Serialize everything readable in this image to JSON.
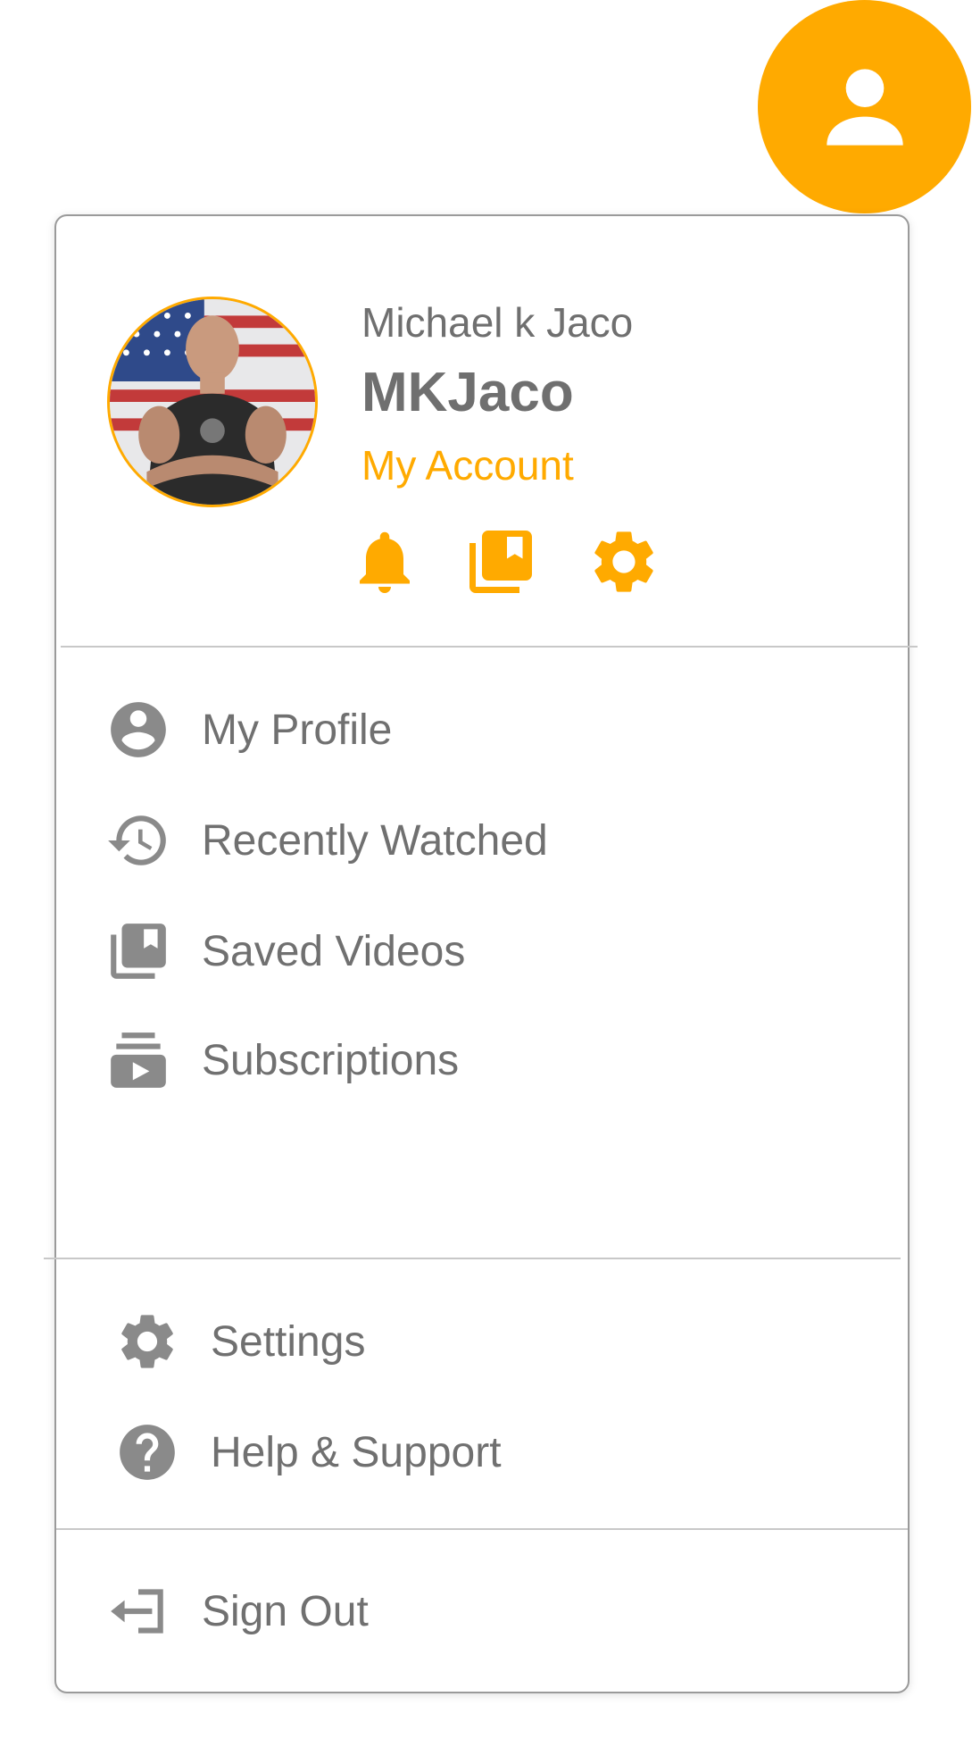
{
  "user": {
    "full_name": "Michael k Jaco",
    "username": "MKJaco",
    "account_link": "My Account"
  },
  "quick_actions": [
    {
      "icon": "bell-icon",
      "name": "notifications"
    },
    {
      "icon": "saved-videos-icon",
      "name": "saved"
    },
    {
      "icon": "gear-icon",
      "name": "settings"
    }
  ],
  "menu": {
    "primary": [
      {
        "label": "My Profile",
        "icon": "account-circle-icon"
      },
      {
        "label": "Recently Watched",
        "icon": "history-icon"
      },
      {
        "label": "Saved Videos",
        "icon": "video-library-icon"
      },
      {
        "label": "Subscriptions",
        "icon": "subscriptions-icon"
      }
    ],
    "secondary": [
      {
        "label": "Settings",
        "icon": "gear-icon"
      },
      {
        "label": "Help & Support",
        "icon": "help-circle-icon"
      }
    ],
    "sign_out": {
      "label": "Sign Out",
      "icon": "sign-out-icon"
    }
  },
  "colors": {
    "accent": "#ffaa00",
    "text": "#707070",
    "icon_gray": "#8a8a8a",
    "border": "#9a9a9a"
  }
}
